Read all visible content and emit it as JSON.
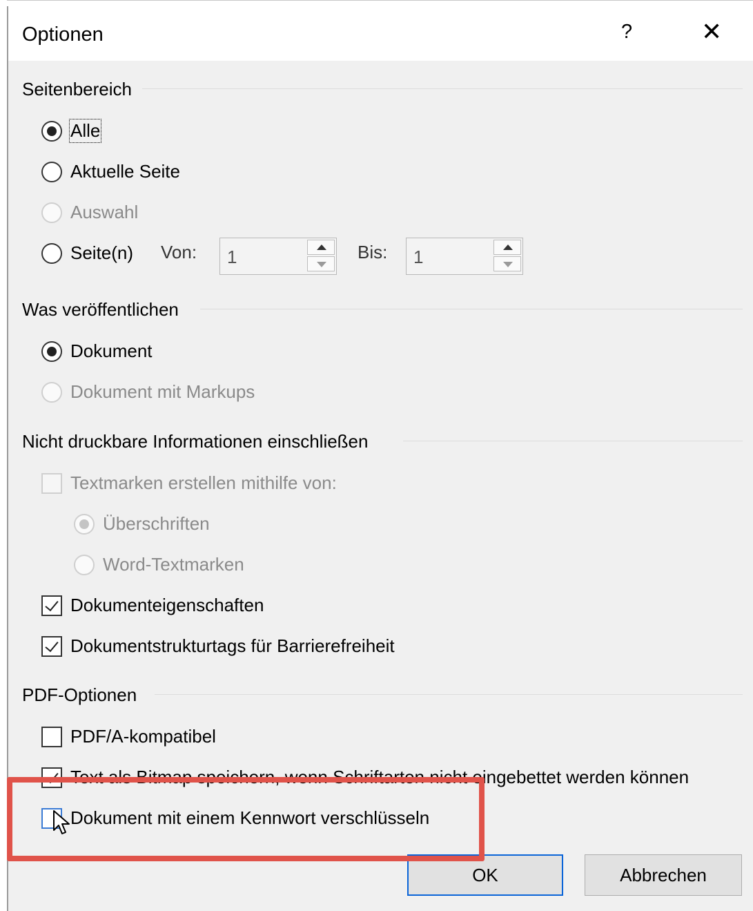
{
  "dialog": {
    "title": "Optionen",
    "help_label": "?",
    "close_label": "✕"
  },
  "sections": {
    "seitenbereich": {
      "title": "Seitenbereich",
      "options": [
        {
          "label": "Alle",
          "checked": true,
          "disabled": false
        },
        {
          "label": "Aktuelle Seite",
          "checked": false,
          "disabled": false
        },
        {
          "label": "Auswahl",
          "checked": false,
          "disabled": true
        },
        {
          "label": "Seite(n)",
          "checked": false,
          "disabled": false
        }
      ],
      "von_label": "Von:",
      "von_value": "1",
      "bis_label": "Bis:",
      "bis_value": "1"
    },
    "was_veroeffentlichen": {
      "title": "Was veröffentlichen",
      "options": [
        {
          "label": "Dokument",
          "checked": true,
          "disabled": false
        },
        {
          "label": "Dokument mit Markups",
          "checked": false,
          "disabled": true
        }
      ]
    },
    "nicht_druckbar": {
      "title": "Nicht druckbare Informationen einschließen",
      "textmarken_label": "Textmarken erstellen mithilfe von:",
      "ueberschriften_label": "Überschriften",
      "word_textmarken_label": "Word-Textmarken",
      "dokumenteigenschaften_label": "Dokumenteigenschaften",
      "strukturtags_label": "Dokumentstrukturtags für Barrierefreiheit"
    },
    "pdf_optionen": {
      "title": "PDF-Optionen",
      "pdfa_label": "PDF/A-kompatibel",
      "bitmap_label": "Text als Bitmap speichern, wenn Schriftarten nicht eingebettet werden können",
      "verschluesseln_label": "Dokument mit einem Kennwort verschlüsseln"
    }
  },
  "buttons": {
    "ok_label": "OK",
    "cancel_label": "Abbrechen"
  },
  "colors": {
    "highlight": "#e0534a",
    "default_button_border": "#0a64d8"
  }
}
